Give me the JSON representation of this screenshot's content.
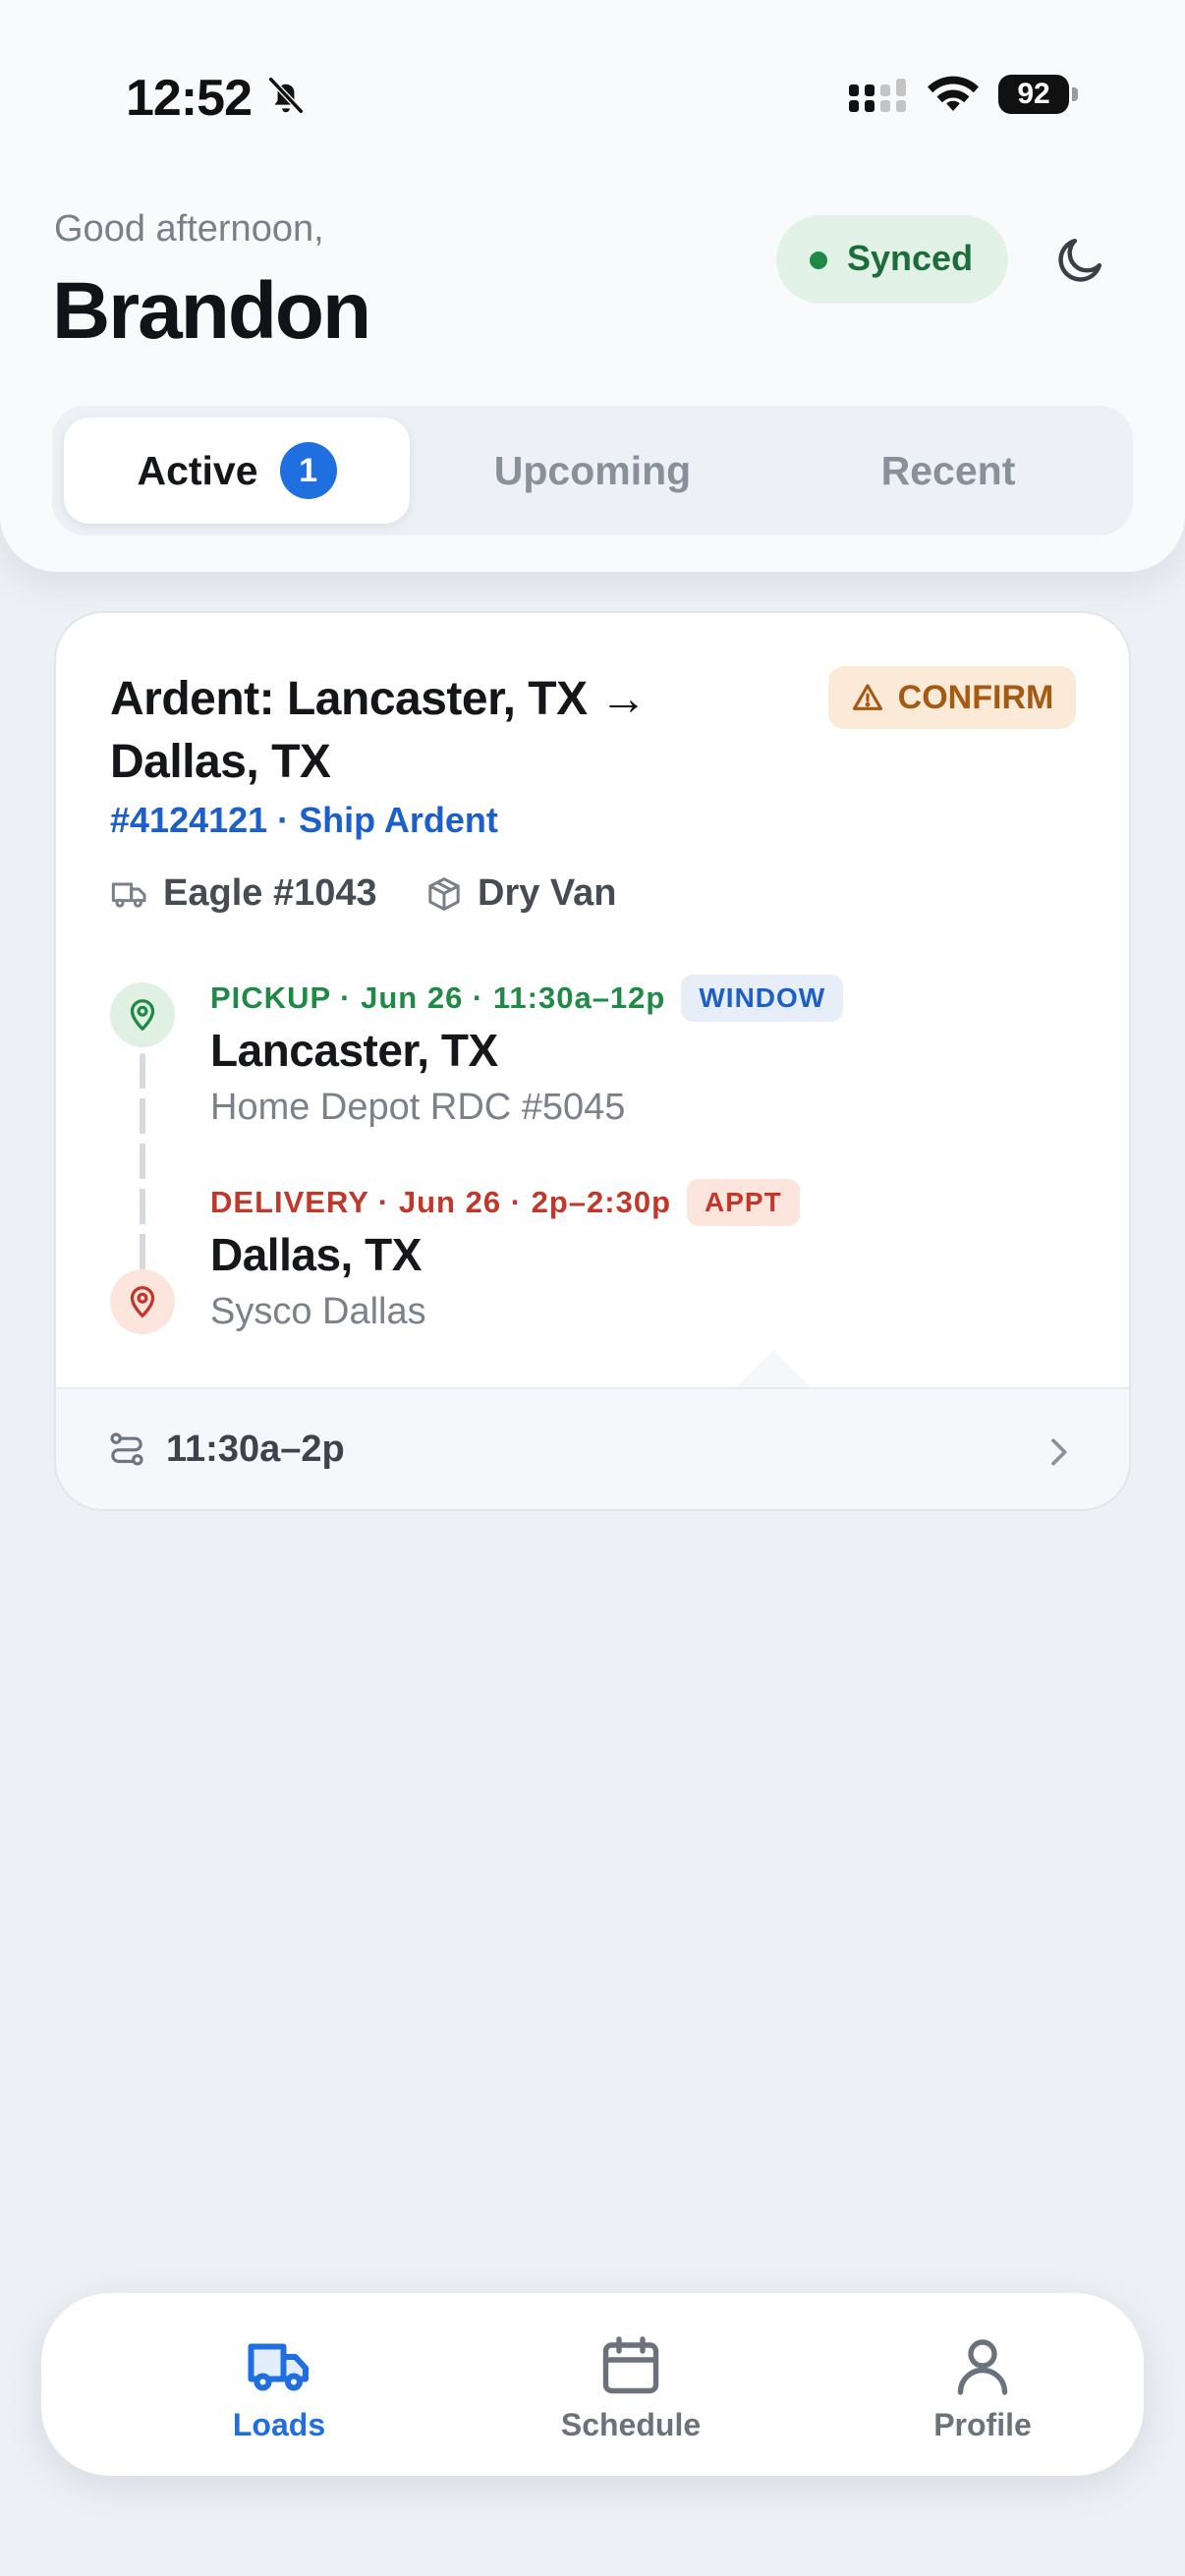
{
  "status_bar": {
    "time": "12:52",
    "battery": "92"
  },
  "header": {
    "greeting": "Good afternoon,",
    "user_name": "Brandon",
    "sync_status": "Synced",
    "tabs": [
      {
        "label": "Active",
        "count": "1",
        "selected": true
      },
      {
        "label": "Upcoming",
        "selected": false
      },
      {
        "label": "Recent",
        "selected": false
      }
    ]
  },
  "load": {
    "title": "Ardent: Lancaster, TX → Dallas, TX",
    "status_badge": "CONFIRM",
    "reference": "#4124121 · Ship Ardent",
    "truck": "Eagle #1043",
    "equipment": "Dry Van",
    "pickup": {
      "meta": "PICKUP · Jun 26 · 11:30a–12p",
      "tag": "WINDOW",
      "city": "Lancaster, TX",
      "facility": "Home Depot RDC #5045"
    },
    "delivery": {
      "meta": "DELIVERY · Jun 26 · 2p–2:30p",
      "tag": "APPT",
      "city": "Dallas, TX",
      "facility": "Sysco Dallas"
    },
    "time_range": "11:30a–2p"
  },
  "bottom_nav": {
    "items": [
      {
        "label": "Loads",
        "icon": "truck-icon",
        "active": true
      },
      {
        "label": "Schedule",
        "icon": "calendar-icon",
        "active": false
      },
      {
        "label": "Profile",
        "icon": "person-icon",
        "active": false
      }
    ]
  },
  "colors": {
    "accent_blue": "#1f6fe0",
    "success_green": "#1f8a46",
    "danger_red": "#c3372a",
    "warning_orange": "#a55a12",
    "background": "#edf0f5"
  }
}
